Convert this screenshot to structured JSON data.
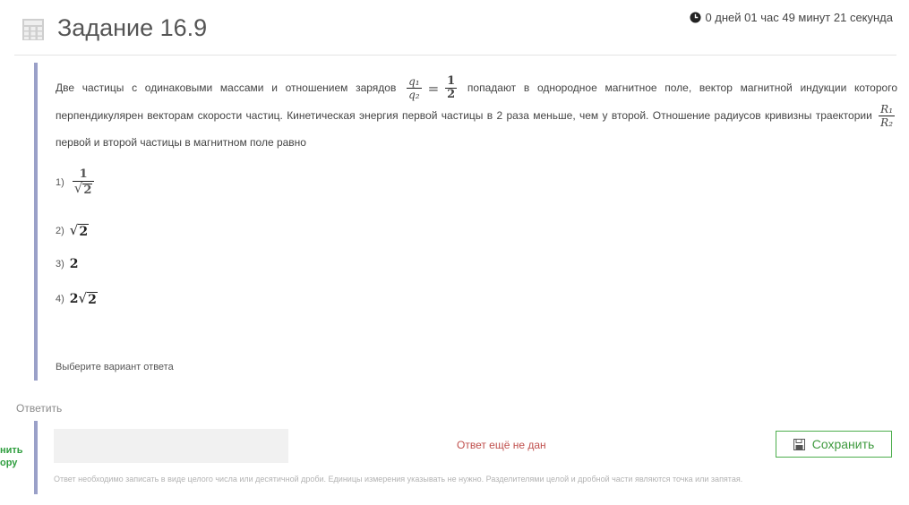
{
  "header": {
    "title": "Задание 16.9",
    "timer": "0 дней 01 час 49 минут 21 секунда"
  },
  "question": {
    "text_part1": "Две частицы с одинаковыми массами и отношением зарядов",
    "ratio_num": "q₁",
    "ratio_den": "q₂",
    "equals": "=",
    "ratio_val_num": "1",
    "ratio_val_den": "2",
    "text_part2": "попадают в однородное магнитное поле, вектор магнитной индукции которого перпендикулярен векторам скорости частиц. Кинетическая энергия первой частицы в 2 раза меньше, чем у второй. Отношение радиусов кривизны траектории",
    "radius_num": "R₁",
    "radius_den": "R₂",
    "text_part3": "первой и второй частицы в магнитном поле равно",
    "options": [
      {
        "label": "1)",
        "num": "1",
        "den_root": "2"
      },
      {
        "label": "2)",
        "root": "2"
      },
      {
        "label": "3)",
        "value": "2"
      },
      {
        "label": "4)",
        "coef": "2",
        "root": "2"
      }
    ],
    "choose_prompt": "Выберите вариант ответа"
  },
  "answer": {
    "section_label": "Ответить",
    "side_link_line1": "нить",
    "side_link_line2": "ору",
    "status": "Ответ ещё не дан",
    "save_label": "Сохранить",
    "hint": "Ответ необходимо записать в виде целого числа или десятичной дроби. Единицы измерения указывать не нужно. Разделителями целой и дробной части являются точка или запятая."
  },
  "colors": {
    "accent_border": "#9aa0c8",
    "save_green": "#4cae4c",
    "status_red": "#c0504d"
  },
  "icons": {
    "task": "calculator-icon",
    "timer": "clock-icon",
    "save": "floppy-disk-icon"
  }
}
